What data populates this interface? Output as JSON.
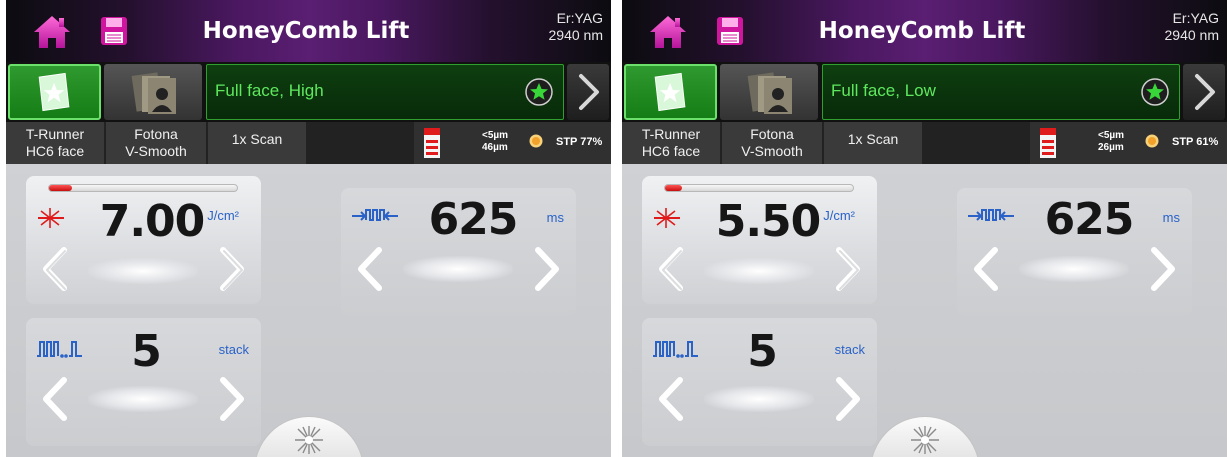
{
  "colors": {
    "header_purple": "#5a1e72",
    "favorite_green": "#2f9a2f",
    "program_text_green": "#5ee85e",
    "unit_blue": "#2a62c8",
    "fluence_red": "#e01b1b",
    "stp_orange": "#f2a12a"
  },
  "icons": {
    "home": "home-icon",
    "save": "save-disk-icon",
    "favorite": "star-folder-icon",
    "user_programs": "user-folder-icon",
    "add_favorite": "star-icon",
    "next": "chevron-right-icon",
    "fluence": "laser-burst-icon",
    "pulse_duration": "pulse-duration-icon",
    "stack": "pulse-train-icon",
    "depth": "depth-gauge-icon",
    "fire": "laser-burst-icon"
  },
  "panels": [
    {
      "title": "HoneyComb Lift",
      "laser_type": "Er:YAG",
      "wavelength": "2940 nm",
      "program": "Full face, High",
      "handpiece_line1": "T-Runner",
      "handpiece_line2": "HC6 face",
      "mode_line1": "Fotona",
      "mode_line2": "V-Smooth",
      "scan": "1x Scan",
      "depth_line1": "<5µm",
      "depth_line2": "46µm",
      "stp": "STP 77%",
      "fluence": {
        "value": "7.00",
        "unit": "J/cm²",
        "level": 0.12
      },
      "pulse": {
        "value": "625",
        "unit": "ms"
      },
      "stack": {
        "value": "5",
        "unit": "stack"
      }
    },
    {
      "title": "HoneyComb Lift",
      "laser_type": "Er:YAG",
      "wavelength": "2940 nm",
      "program": "Full face, Low",
      "handpiece_line1": "T-Runner",
      "handpiece_line2": "HC6 face",
      "mode_line1": "Fotona",
      "mode_line2": "V-Smooth",
      "scan": "1x Scan",
      "depth_line1": "<5µm",
      "depth_line2": "26µm",
      "stp": "STP 61%",
      "fluence": {
        "value": "5.50",
        "unit": "J/cm²",
        "level": 0.09
      },
      "pulse": {
        "value": "625",
        "unit": "ms"
      },
      "stack": {
        "value": "5",
        "unit": "stack"
      }
    }
  ]
}
